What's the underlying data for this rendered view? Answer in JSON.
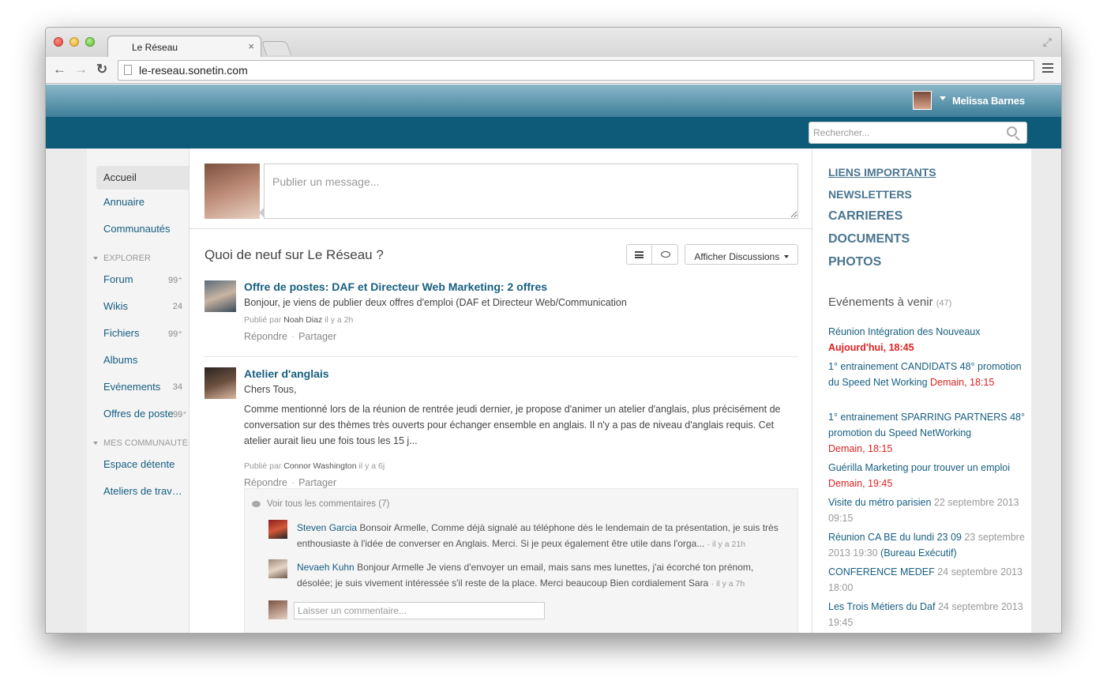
{
  "browser": {
    "tab_title": "Le Réseau",
    "tab_close": "×",
    "url": "le-reseau.sonetin.com",
    "back_glyph": "←",
    "forward_glyph": "→",
    "reload_glyph": "↻",
    "fullscreen_glyph": "⤢"
  },
  "header": {
    "user_name": "Melissa Barnes",
    "search_placeholder": "Rechercher..."
  },
  "sidebar": {
    "items": [
      {
        "label": "Accueil"
      },
      {
        "label": "Annuaire"
      },
      {
        "label": "Communautés"
      }
    ],
    "explorer_title": "EXPLORER",
    "explorer_items": [
      {
        "label": "Forum",
        "count": "99⁺"
      },
      {
        "label": "Wikis",
        "count": "24"
      },
      {
        "label": "Fichiers",
        "count": "99⁺"
      },
      {
        "label": "Albums",
        "count": ""
      },
      {
        "label": "Evénements",
        "count": "34"
      },
      {
        "label": "Offres de postes",
        "count": "99⁺"
      }
    ],
    "communities_title": "MES COMMUNAUTÉS",
    "community_items": [
      {
        "label": "Espace détente"
      },
      {
        "label": "Ateliers de trav…"
      }
    ]
  },
  "composer": {
    "placeholder": "Publier un message..."
  },
  "feed": {
    "title": "Quoi de neuf sur Le Réseau ?",
    "filter_label": "Afficher Discussions",
    "posts": [
      {
        "title": "Offre de postes: DAF et Directeur Web Marketing: 2 offres",
        "text": "Bonjour, je viens de publier deux offres d'emploi (DAF et Directeur Web/Communication",
        "meta_prefix": "Publié par",
        "author": "Noah Diaz",
        "time": "il y a 2h",
        "reply": "Répondre",
        "share": "Partager"
      },
      {
        "title": "Atelier d'anglais",
        "greeting": "Chers Tous,",
        "text": "Comme mentionné lors de la réunion de rentrée jeudi dernier, je propose d'animer un atelier d'anglais, plus précisément de conversation sur des thèmes très ouverts pour échanger ensemble en anglais. Il n'y a pas de niveau d'anglais requis. Cet atelier aurait lieu une fois tous les 15 j...",
        "meta_prefix": "Publié par",
        "author": "Connor Washington",
        "time": "il y a 6j",
        "reply": "Répondre",
        "share": "Partager"
      }
    ],
    "comments": {
      "header": "Voir tous les commentaires (7)",
      "items": [
        {
          "author": "Steven Garcia",
          "text": "Bonsoir Armelle, Comme déjà signalé au téléphone dès le lendemain de ta présentation, je suis très enthousiaste à l'idée de converser en Anglais. Merci. Si je peux également être utile dans l'orga...",
          "time": "· il y a 21h"
        },
        {
          "author": "Nevaeh Kuhn",
          "text": "Bonjour Armelle Je viens d'envoyer un email, mais sans mes lunettes, j'ai écorché ton prénom, désolée; je suis vivement intéressée s'il reste de la place. Merci beaucoup Bien cordialement Sara",
          "time": "· il y a 7h"
        }
      ],
      "input_placeholder": "Laisser un commentaire..."
    }
  },
  "rightbar": {
    "links": [
      "LIENS IMPORTANTS",
      "NEWSLETTERS",
      "CARRIERES",
      "DOCUMENTS",
      "PHOTOS"
    ],
    "events_title": "Evénements à venir",
    "events_count": "(47)",
    "events": [
      {
        "name": "Réunion Intégration des Nouveaux",
        "date": "Aujourd'hui, 18:45"
      },
      {
        "name": "1° entrainement CANDIDATS 48° promotion du Speed Net Working",
        "date": "Demain, 18:15"
      },
      {
        "name": "1° entrainement SPARRING PARTNERS 48° promotion du Speed NetWorking",
        "date": "Demain, 18:15"
      },
      {
        "name": "Guérilla Marketing pour trouver un emploi",
        "date": "Demain, 19:45"
      },
      {
        "name": "Visite du métro parisien",
        "date": "22 septembre 2013 09:15"
      },
      {
        "name": "Réunion CA BE du lundi 23 09",
        "date": "23 septembre 2013 19:30",
        "extra": "(Bureau Exécutif)"
      },
      {
        "name": "CONFERENCE MEDEF",
        "date": "24 septembre 2013 18:00"
      },
      {
        "name": "Les Trois Métiers du Daf",
        "date": "24 septembre 2013 19:45"
      }
    ]
  },
  "colors": {
    "link": "#155e80",
    "header_dark": "#0e5a79",
    "header_light": "#8ab8ca",
    "today": "#e02020"
  }
}
